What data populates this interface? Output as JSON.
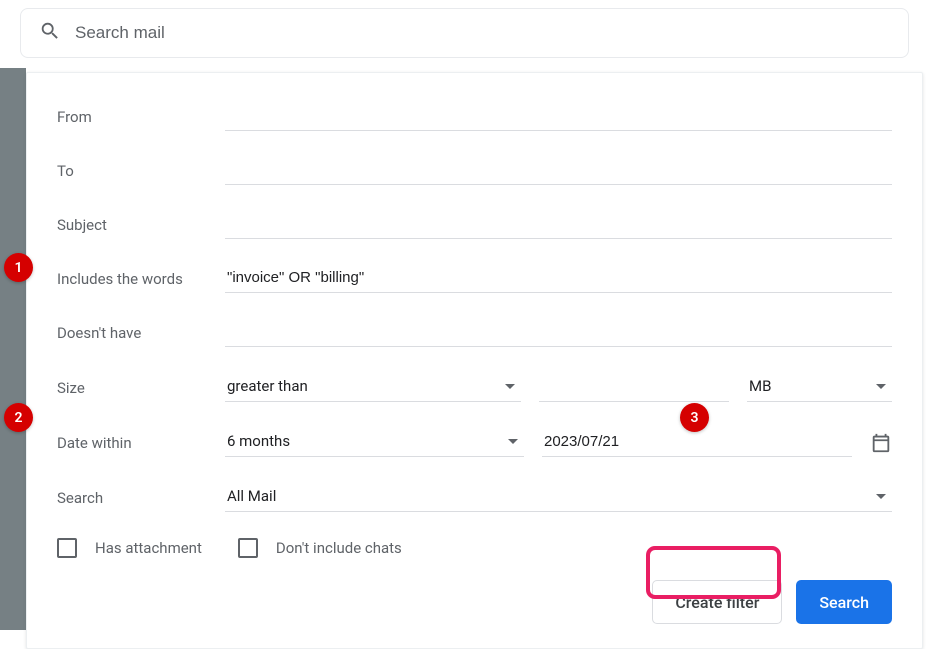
{
  "search": {
    "placeholder": "Search mail"
  },
  "filter": {
    "from_label": "From",
    "to_label": "To",
    "subject_label": "Subject",
    "includes_label": "Includes the words",
    "includes_value": "\"invoice\" OR \"billing\"",
    "doesnt_have_label": "Doesn't have",
    "size_label": "Size",
    "size_op": "greater than",
    "size_unit": "MB",
    "date_label": "Date within",
    "date_range": "6 months",
    "date_value": "2023/07/21",
    "search_label": "Search",
    "search_scope": "All Mail",
    "has_attachment_label": "Has attachment",
    "no_chats_label": "Don't include chats"
  },
  "buttons": {
    "create_filter": "Create filter",
    "search": "Search"
  },
  "badges": [
    "1",
    "2",
    "3"
  ]
}
